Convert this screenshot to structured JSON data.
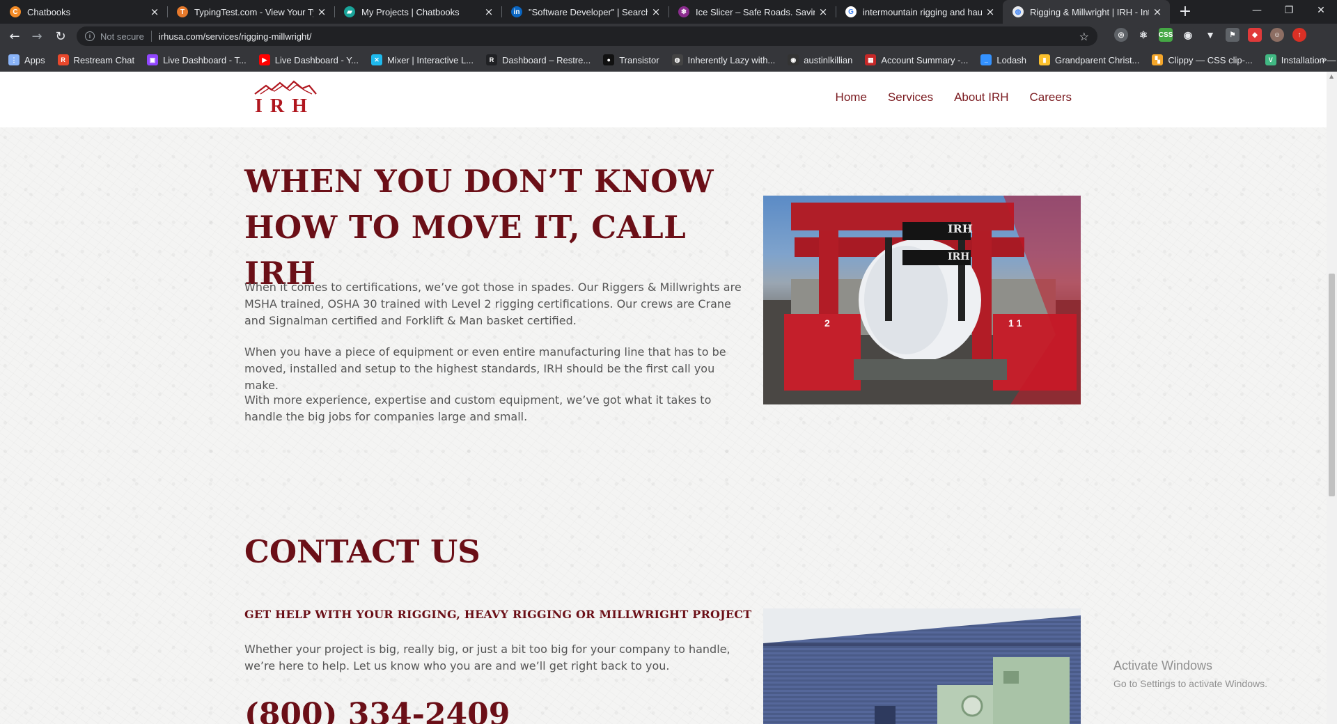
{
  "browser": {
    "tabs": [
      {
        "title": "Chatbooks",
        "favicon": "chatbooks-icon",
        "color": "#f38b26",
        "glyph": "C"
      },
      {
        "title": "TypingTest.com - View Your Typin",
        "favicon": "typingtest-icon",
        "color": "#e77a2c",
        "glyph": "T"
      },
      {
        "title": "My Projects | Chatbooks",
        "favicon": "chatbooks-projects-icon",
        "color": "#19a49a",
        "glyph": "▰"
      },
      {
        "title": "\"Software Developer\" | Search | Li",
        "favicon": "linkedin-icon",
        "color": "#0a66c2",
        "glyph": "in"
      },
      {
        "title": "Ice Slicer – Safe Roads. Saving Liv",
        "favicon": "iceslicer-icon",
        "color": "#8b2c8f",
        "glyph": "❄"
      },
      {
        "title": "intermountain rigging and haulin",
        "favicon": "google-icon",
        "color": "#ffffff",
        "glyph": "G"
      },
      {
        "title": "Rigging & Millwright | IRH - Inter",
        "favicon": "globe-icon",
        "color": "#e8eaed",
        "glyph": "◍"
      }
    ],
    "new_tab": "+",
    "window_controls": {
      "minimize": "—",
      "restore": "❐",
      "close": "✕"
    },
    "omnibox": {
      "security": "Not secure",
      "url": "irhusa.com/services/rigging-millwright/"
    },
    "bookmarks": [
      {
        "label": "Apps",
        "color": "#8ab4f8",
        "glyph": "⋮"
      },
      {
        "label": "Restream Chat",
        "color": "#e8482c",
        "glyph": "R"
      },
      {
        "label": "Live Dashboard - T...",
        "color": "#9146ff",
        "glyph": "▣"
      },
      {
        "label": "Live Dashboard - Y...",
        "color": "#ff0000",
        "glyph": "▶"
      },
      {
        "label": "Mixer | Interactive L...",
        "color": "#1fbaed",
        "glyph": "✕"
      },
      {
        "label": "Dashboard – Restre...",
        "color": "#202124",
        "glyph": "R"
      },
      {
        "label": "Transistor",
        "color": "#111111",
        "glyph": "●"
      },
      {
        "label": "Inherently Lazy with...",
        "color": "#444444",
        "glyph": "◍"
      },
      {
        "label": "austinlkillian",
        "color": "#333333",
        "glyph": "◉"
      },
      {
        "label": "Account Summary -...",
        "color": "#c62828",
        "glyph": "▦"
      },
      {
        "label": "Lodash",
        "color": "#3492ff",
        "glyph": "_"
      },
      {
        "label": "Grandparent Christ...",
        "color": "#fbc02d",
        "glyph": "▮"
      },
      {
        "label": "Clippy — CSS clip-...",
        "color": "#f4a62a",
        "glyph": "▚"
      },
      {
        "label": "Installation — Vue.js",
        "color": "#41b883",
        "glyph": "V"
      }
    ],
    "bookmarks_overflow": "»"
  },
  "site": {
    "logo_text": "IRH",
    "nav": [
      "Home",
      "Services",
      "About IRH",
      "Careers"
    ],
    "headline": "WHEN YOU DON’T KNOW HOW TO MOVE IT, CALL IRH",
    "paragraphs": [
      "When it comes to certifications, we’ve got those in spades. Our Riggers & Millwrights are MSHA trained, OSHA 30 trained with Level 2 rigging certifications. Our crews are Crane and Signalman certified and Forklift & Man basket certified.",
      "When you have a piece of equipment or even entire manufacturing line that has to be moved, installed and setup to the highest standards, IRH should be the first call you make.",
      "With more experience, expertise and custom equipment, we’ve got what it takes to handle the big jobs for companies large and small."
    ],
    "contact": {
      "heading": "CONTACT US",
      "subheading": "GET HELP WITH YOUR RIGGING, HEAVY RIGGING OR MILLWRIGHT PROJECT",
      "text": "Whether your project is big, really big, or just a bit too big for your company to handle, we’re here to help. Let us know who you are and we’ll get right back to you.",
      "phone": "(800) 334-2409"
    },
    "image1_signs": [
      "IRH",
      "IRH"
    ],
    "image1_numbers": [
      "2",
      "1 1"
    ],
    "accent_color": "#6b0f17"
  },
  "os_watermark": {
    "title": "Activate Windows",
    "subtitle": "Go to Settings to activate Windows."
  }
}
